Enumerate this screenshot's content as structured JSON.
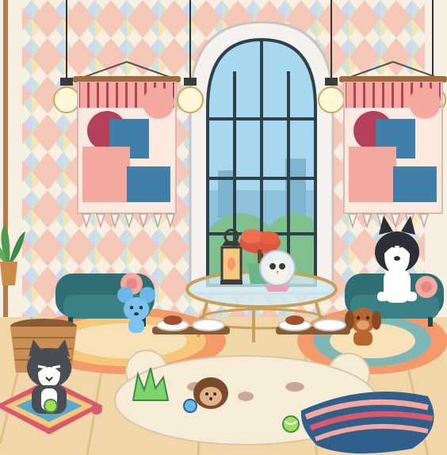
{
  "scene": {
    "kind": "pet-lounge-room",
    "colors": {
      "wall_diamond_a": "#f4c7b8",
      "wall_diamond_b": "#cfe3d8",
      "wall_diamond_c": "#c9d9ef",
      "wall_diamond_d": "#f7e6b5",
      "wall_base": "#f7efe2",
      "floor": "#f0d6a8",
      "floor_line": "#e3bf88",
      "window_frame": "#f4f1ee",
      "window_sky": "#a8d8ef",
      "tapestry_pink": "#f3a8a0",
      "tapestry_blue": "#3f7fa8",
      "tapestry_maroon": "#b5405a",
      "sofa_teal": "#2f6f73",
      "rug_orange": "#f39a6a",
      "rug_bear": "#f7ecd8",
      "cushion_stripe": "#2f5f8a",
      "cushion_red": "#d95a6a"
    },
    "icons": [
      "pendant-lamp-icon",
      "arched-window-icon",
      "tapestry-icon",
      "teal-sofa-icon",
      "glass-coffee-table-icon",
      "lantern-icon",
      "bonsai-tree-icon",
      "owl-crystal-ball-icon",
      "husky-dog-icon",
      "brown-puppy-icon",
      "blue-mouse-icon",
      "grey-cat-icon",
      "hedgehog-icon",
      "pet-food-bowl-icon",
      "wicker-basket-icon",
      "potted-plant-icon",
      "bear-rug-icon",
      "striped-cushion-icon",
      "tennis-ball-icon",
      "grass-tuft-icon"
    ]
  }
}
